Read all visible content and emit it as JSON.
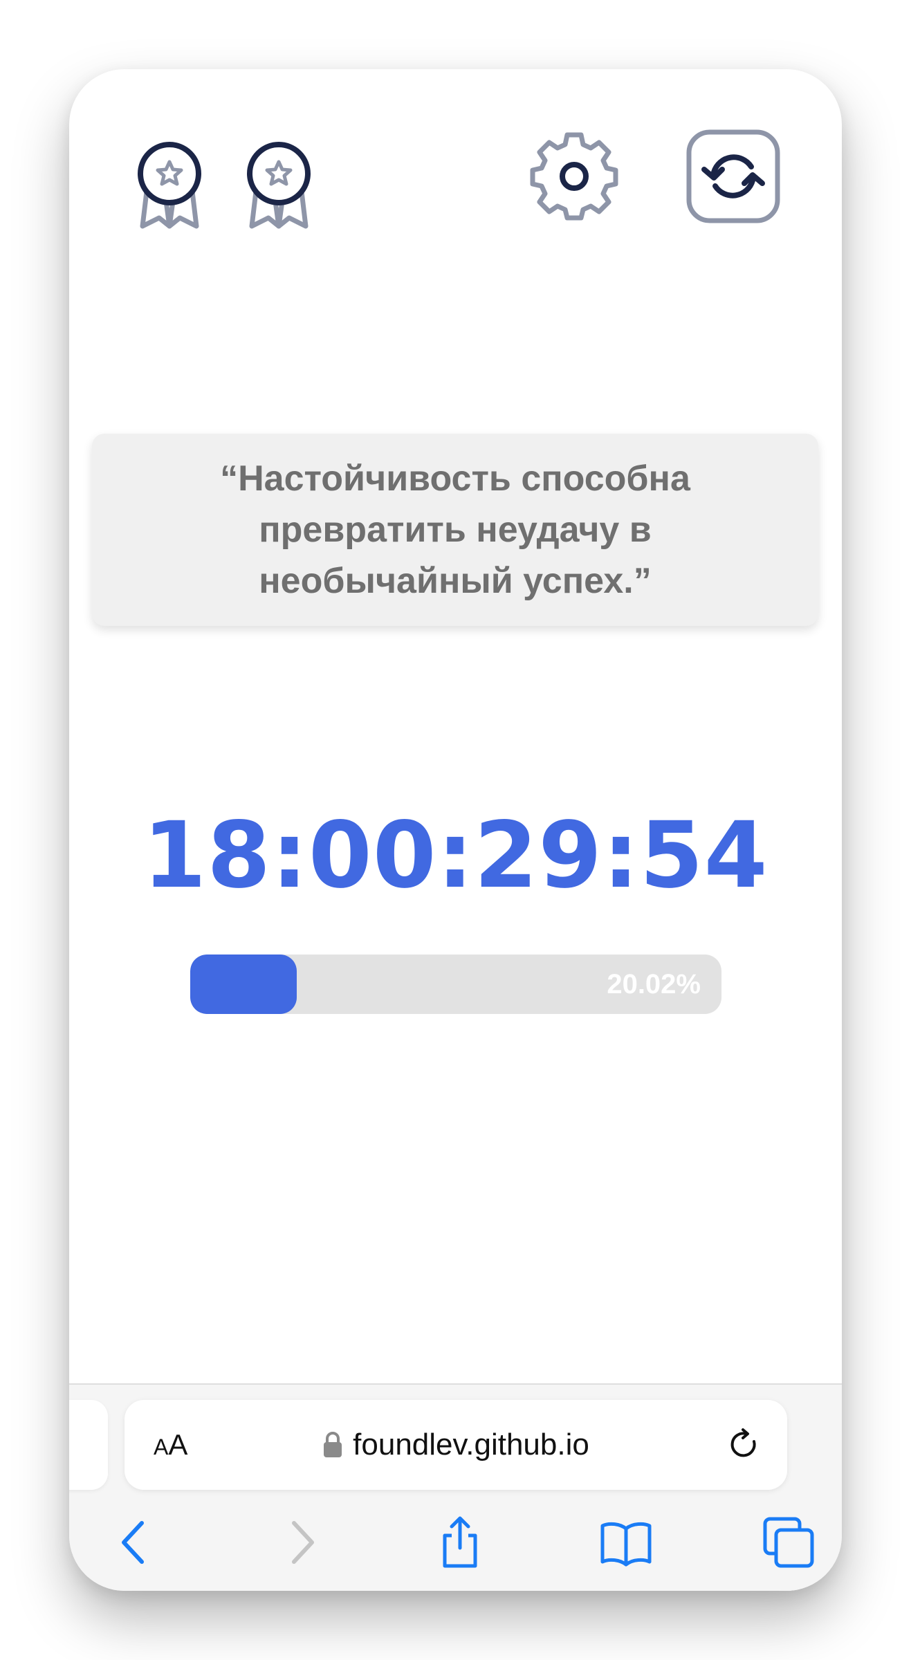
{
  "header": {
    "icons": [
      "medal-icon",
      "medal-icon",
      "gear-icon",
      "refresh-icon"
    ]
  },
  "quote": {
    "text": "“Настойчивость способна превратить неудачу в необычайный успех.”"
  },
  "timer": {
    "value": "18:00:29:54"
  },
  "progress": {
    "percent": 20.02,
    "label": "20.02%"
  },
  "browser": {
    "text_size_button": "AA",
    "url": "foundlev.github.io",
    "toolbar_icons": [
      "chevron-left-icon",
      "chevron-right-icon",
      "share-icon",
      "bookmarks-icon",
      "tabs-icon"
    ]
  },
  "colors": {
    "accent": "#4169E1",
    "icon_dark": "#1B2547",
    "icon_gray": "#8E95A8",
    "safari_blue": "#1A7CF5"
  }
}
